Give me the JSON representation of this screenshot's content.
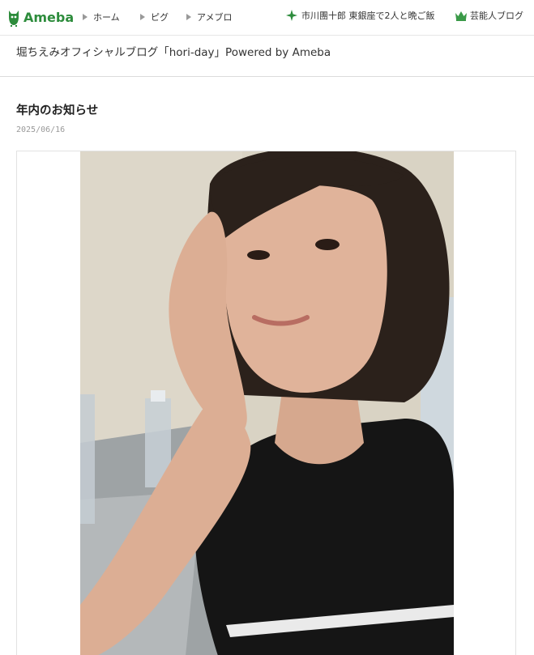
{
  "global_header": {
    "logo_text": "Ameba",
    "nav": [
      {
        "label": "ホーム"
      },
      {
        "label": "ピグ"
      },
      {
        "label": "アメブロ"
      }
    ],
    "topic_link": "市川團十郎 東銀座で2人と晩ご飯",
    "geino_link": "芸能人ブログ",
    "colors": {
      "brand": "#2d8c3c",
      "crown": "#3a9a48",
      "nav_arrow": "#999999"
    },
    "icons": {
      "logo": "ameba-logo-icon",
      "nav": "triangle-right-icon",
      "topic": "sparkle-icon",
      "geino": "crown-icon"
    }
  },
  "blog": {
    "title": "堀ちえみオフィシャルブログ「hori-day」Powered by Ameba"
  },
  "article": {
    "title": "年内のお知らせ",
    "date": "2025/06/16",
    "photo": {
      "description_icon": "selfie-photo",
      "colors": {
        "wall": "#d9d3c4",
        "shirt": "#151515",
        "hair": "#2b211b",
        "skin": "#e0b39a",
        "table": "#9ea3a5"
      }
    }
  }
}
